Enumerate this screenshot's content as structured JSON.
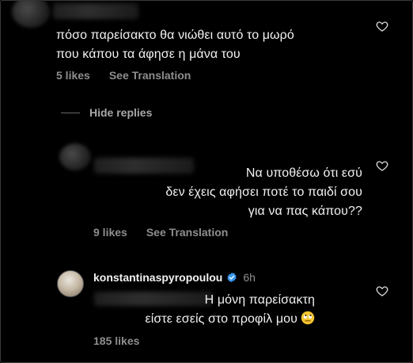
{
  "comments": [
    {
      "text_line1": "πόσο παρείσακτο θα νιώθει αυτό το μωρό",
      "text_line2": "που κάπου τα άφησε η μάνα του",
      "likes": "5 likes",
      "translate": "See Translation"
    },
    {
      "text_line1": "Να υποθέσω ότι εσύ",
      "text_line2": "δεν έχεις αφήσει ποτέ το παιδί σου",
      "text_line3": "για να πας κάπου??",
      "likes": "9 likes",
      "translate": "See Translation"
    },
    {
      "username": "konstantinaspyropoulou",
      "time": "6h",
      "text_line1": "Η μόνη παρείσακτη",
      "text_line2": "είστε εσείς στο προφίλ μου",
      "emoji_icon": "rolling-eyes-emoji",
      "likes": "185 likes"
    }
  ],
  "thread": {
    "hide_replies": "Hide replies"
  },
  "colors": {
    "background": "#000000",
    "text": "#f2f2f2",
    "muted": "#8e8e8e",
    "verified": "#3897f0"
  }
}
